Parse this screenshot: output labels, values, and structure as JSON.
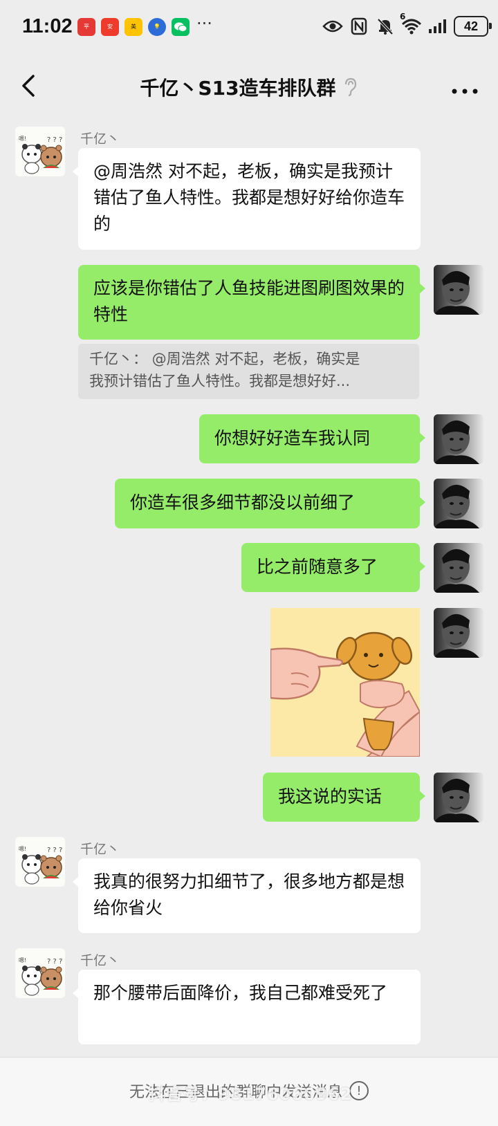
{
  "status_bar": {
    "time": "11:02",
    "apps": [
      {
        "name": "pingan-bank-icon",
        "color": "#e53935"
      },
      {
        "name": "pingan-app-icon",
        "color": "#ef3b2c"
      },
      {
        "name": "meituan-icon",
        "color": "#ffc300"
      },
      {
        "name": "tips-icon",
        "color": "#2d6bd6"
      },
      {
        "name": "wechat-icon",
        "color": "#07c160"
      }
    ],
    "more_dots": "···",
    "network_label": "6",
    "battery": "42"
  },
  "header": {
    "title": "千亿丶S13造车排队群"
  },
  "messages": [
    {
      "sender": "千亿丶",
      "text": "@周浩然  对不起，老板，确实是我预计错估了鱼人特性。我都是想好好给你造车的"
    },
    {
      "text": "应该是你错估了人鱼技能进图刷图效果的特性"
    },
    {
      "quote_line1": "千亿丶：  @周浩然 对不起，老板，确实是",
      "quote_line2": "我预计错估了鱼人特性。我都是想好好..."
    },
    {
      "text": "你想好好造车我认同"
    },
    {
      "text": "你造车很多细节都没以前细了"
    },
    {
      "text": "比之前随意多了"
    },
    {
      "text": "我这说的实话"
    },
    {
      "sender": "千亿丶",
      "text": "我真的很努力扣细节了，很多地方都是想给你省火"
    },
    {
      "sender": "千亿丶",
      "text": "那个腰带后面降价，我自己都难受死了"
    }
  ],
  "sticker_icon": "dog-pointing-sticker",
  "bottom": {
    "notice": "无法在已退出的群聊中发送消息",
    "watermark": "抖音号：98176060962"
  }
}
